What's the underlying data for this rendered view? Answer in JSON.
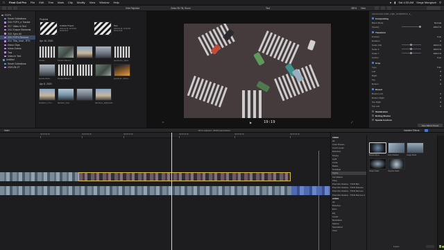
{
  "menubar": {
    "app": "Final Cut Pro",
    "items": [
      "File",
      "Edit",
      "Trim",
      "Mark",
      "Clip",
      "Modify",
      "View",
      "Window",
      "Help"
    ],
    "clock": "Sat 4:33 AM",
    "user": "Serge Mangisch"
  },
  "sidebar": {
    "library": "FCPX",
    "items": [
      {
        "label": "Smart Collections",
        "type": "star"
      },
      {
        "label": "218. FCPX_e Tracker",
        "type": "event"
      },
      {
        "label": "217. Video in Text",
        "type": "event"
      },
      {
        "label": "216. Ensure Elements",
        "type": "event"
      },
      {
        "label": "215. Sync All",
        "type": "event"
      },
      {
        "label": "220. FCPX Remove",
        "type": "event",
        "selected": true
      },
      {
        "label": "214. Tilta_Unat - RTX",
        "type": "event"
      },
      {
        "label": "Demo Clips",
        "type": "event"
      },
      {
        "label": "Intros Outros",
        "type": "event"
      },
      {
        "label": "Test",
        "type": "event"
      },
      {
        "label": "Video in Text",
        "type": "event"
      },
      {
        "label": "Untitled",
        "type": "folder"
      },
      {
        "label": "Smart Collections",
        "type": "star"
      },
      {
        "label": "2020-05-27",
        "type": "event"
      }
    ]
  },
  "browser": {
    "projects_header": "Projects",
    "projects": [
      {
        "title": "Untitled Project",
        "meta": "2020-04-16, 10:19 PM\n00:00:05:11"
      },
      {
        "title": "Test",
        "meta": "2020-04-16, 10:18 PM\n00:00:10:01"
      }
    ],
    "date1": "Apr 16, 2020",
    "date2": "Apr 8, 2020",
    "clips1": [
      "Pexels",
      "Pexels Videos 1",
      "...",
      "pexels-loo_1bud..."
    ],
    "clips2": [
      "pexels-photo...",
      "Pexels Videos 2",
      "...",
      "pexels-le...photo..."
    ],
    "clips3": [
      "kangkoo_1 hm...",
      "lawiwes_zing...",
      "...",
      "hai luuyo_s@pexels..."
    ]
  },
  "viewer": {
    "filter": "Hide Rejected",
    "clip_name": "Zebra Rit-Tilt, Room",
    "tab": "Test",
    "zoom": "350%",
    "view": "View",
    "timecode": "19:19"
  },
  "inspector": {
    "filename": "videoblocks-traffic_night_arrQ6ZJZxU_1_",
    "compositing": "Compositing",
    "blend_mode_label": "Blend Mode",
    "blend_mode": "Normal",
    "opacity_label": "Opacity",
    "opacity": "100.0 %",
    "transform": "Transform",
    "position_label": "Position",
    "position_x": "0 px",
    "position_y": "0 px",
    "rotation_label": "Rotation",
    "rotation": "0",
    "scale_all_label": "Scale (All)",
    "scale_all": "100.0 %",
    "scale_x_label": "Scale X",
    "scale_x": "100.0 %",
    "scale_y_label": "Scale Y",
    "scale_y": "100.0 %",
    "anchor_label": "Anchor",
    "anchor": "0 px",
    "crop": "Crop",
    "type_label": "Type",
    "type": "Trim",
    "left_label": "Left",
    "left": "0",
    "right_label": "Right",
    "right": "0",
    "top_label": "Top",
    "top": "0",
    "bottom_label": "Bottom",
    "bottom": "0",
    "distort": "Distort",
    "bl_label": "Bottom Left",
    "bl": "0",
    "br_label": "Bottom Right",
    "br": "0",
    "tr_label": "Top Right",
    "tr": "0",
    "tl_label": "Top Left",
    "tl": "0",
    "stabilization": "Stabilization",
    "rolling_shutter": "Rolling Shutter",
    "spatial_conform": "Spatial Conform",
    "save_preset": "Save Effects Preset"
  },
  "timeline_bar": {
    "index": "Index",
    "info": "00:11 selected - 28:09 total duration",
    "effects_title": "Installed Effects"
  },
  "timeline": {
    "ruler": [
      "00:00:00:00",
      "00:00:05:00",
      "00:00:10:00",
      "00:00:15:00",
      "00:00:20:00",
      "00:00:25:00"
    ]
  },
  "effects": {
    "list": [
      {
        "label": "VIDEO",
        "hdr": true
      },
      {
        "label": "All"
      },
      {
        "label": "Color Presets"
      },
      {
        "label": "Comic Looks"
      },
      {
        "label": "Distortion"
      },
      {
        "label": "Keying"
      },
      {
        "label": "Light"
      },
      {
        "label": "Looks"
      },
      {
        "label": "Masks"
      },
      {
        "label": "Nostalgia"
      },
      {
        "label": "Stylize",
        "sel": true
      },
      {
        "label": "Text Effects"
      },
      {
        "label": "Tiling"
      },
      {
        "label": "Pixel Film Studios - TVFR Blur"
      },
      {
        "label": "Pixel Film Studios - TVFR Dissolve"
      },
      {
        "label": "Pixel Film Studios - TVFR Remove"
      },
      {
        "label": "Pixel Film Studios - TVFR Remove 2"
      },
      {
        "label": "AUDIO",
        "hdr": true
      },
      {
        "label": "All"
      },
      {
        "label": "Distortion"
      },
      {
        "label": "Echo"
      },
      {
        "label": "EQ"
      },
      {
        "label": "Levels"
      },
      {
        "label": "Modulation"
      },
      {
        "label": "Spaces"
      },
      {
        "label": "Specialized"
      },
      {
        "label": "Voice"
      }
    ],
    "thumbs": [
      "Broad Adjust",
      "Drop Shadow",
      "Image Mask",
      "Shape Mask",
      "Vignette Mask"
    ],
    "count": "5 items"
  }
}
